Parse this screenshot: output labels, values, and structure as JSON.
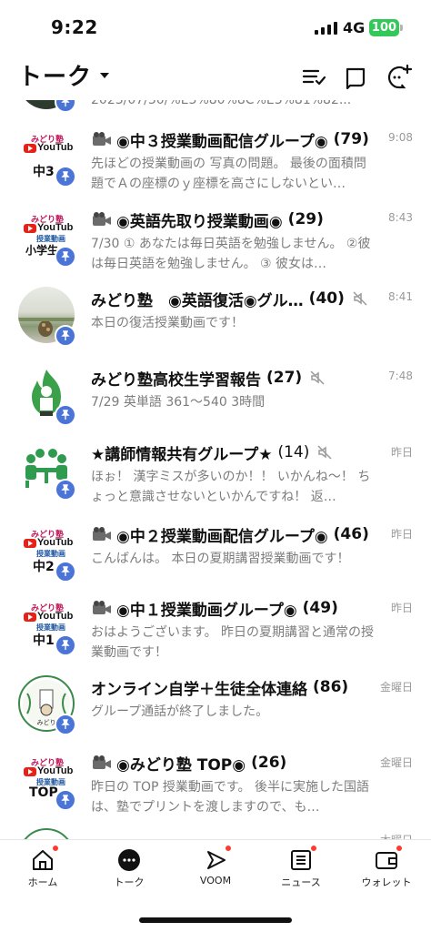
{
  "status": {
    "time": "9:22",
    "network": "4G",
    "battery": "100"
  },
  "header": {
    "title": "トーク"
  },
  "partial_top": {
    "preview": "2023/07/30/%E3%80%8C%E3%81%82..."
  },
  "chats": [
    {
      "title": "◉中３授業動画配信グループ◉",
      "count": "(79)",
      "time": "9:08",
      "preview": "先ほどの授業動画の 写真の問題。 最後の面積問題でＡの座標のｙ座標を高さにしないとい…",
      "avatar": "youtube",
      "grade": "中3",
      "camera": true,
      "muted": false
    },
    {
      "title": "◉英語先取り授業動画◉",
      "count": "(29)",
      "time": "8:43",
      "preview": "7/30 ① あなたは毎日英語を勉強しません。 ②彼は毎日英語を勉強しません。 ③ 彼女は…",
      "avatar": "youtube",
      "grade": "小学生",
      "camera": true,
      "muted": false
    },
    {
      "title": "みどり塾　◉英語復活◉グル…",
      "count": "(40)",
      "time": "8:41",
      "preview": "本日の復活授業動画です！",
      "avatar": "photo",
      "camera": false,
      "muted": true
    },
    {
      "title": "みどり塾高校生学習報告",
      "count": "(27)",
      "time": "7:48",
      "preview": "7/29 英単語 361〜540 3時間",
      "avatar": "fire",
      "camera": false,
      "muted": true
    },
    {
      "title": "★講師情報共有グループ★",
      "count": "(14)",
      "time": "昨日",
      "preview": "ほぉ！ 漢字ミスが多いのか！！ いかんね〜！ ちょっと意識させないといかんですね！ 返…",
      "avatar": "meeting",
      "camera": false,
      "muted": true
    },
    {
      "title": "◉中２授業動画配信グループ◉",
      "count": "(46)",
      "time": "昨日",
      "preview": "こんばんは。 本日の夏期講習授業動画です！",
      "avatar": "youtube",
      "grade": "中2",
      "camera": true,
      "muted": false
    },
    {
      "title": "◉中１授業動画グループ◉",
      "count": "(49)",
      "time": "昨日",
      "preview": "おはようございます。 昨日の夏期講習と通常の授業動画です！",
      "avatar": "youtube",
      "grade": "中1",
      "camera": true,
      "muted": false
    },
    {
      "title": "オンライン自学＋生徒全体連絡",
      "count": "(86)",
      "time": "金曜日",
      "preview": "グループ通話が終了しました。",
      "avatar": "emblem",
      "camera": false,
      "muted": false
    },
    {
      "title": "◉みどり塾 TOP◉",
      "count": "(26)",
      "time": "金曜日",
      "preview": "昨日の TOP 授業動画です。 後半に実施した国語は、塾でプリントを渡しますので、も…",
      "avatar": "youtube",
      "grade": "TOP",
      "camera": true,
      "muted": false
    },
    {
      "title": "",
      "count": "",
      "time": "木曜日",
      "preview": "",
      "avatar": "emblem",
      "camera": false,
      "muted": false
    }
  ],
  "youtube_avatar": {
    "brand": "みどり塾",
    "logo_word": "YouTube",
    "subtitle": "授業動画"
  },
  "tabs": [
    {
      "label": "ホーム",
      "icon": "home-icon",
      "dot": true
    },
    {
      "label": "トーク",
      "icon": "chat-bubble-icon",
      "dot": false
    },
    {
      "label": "VOOM",
      "icon": "voom-icon",
      "dot": true
    },
    {
      "label": "ニュース",
      "icon": "news-icon",
      "dot": true
    },
    {
      "label": "ウォレット",
      "icon": "wallet-icon",
      "dot": true
    }
  ],
  "colors": {
    "pin": "#4a74d6",
    "battery": "#34c759",
    "dot": "#ff3b30",
    "preview": "#7c7c7c"
  }
}
